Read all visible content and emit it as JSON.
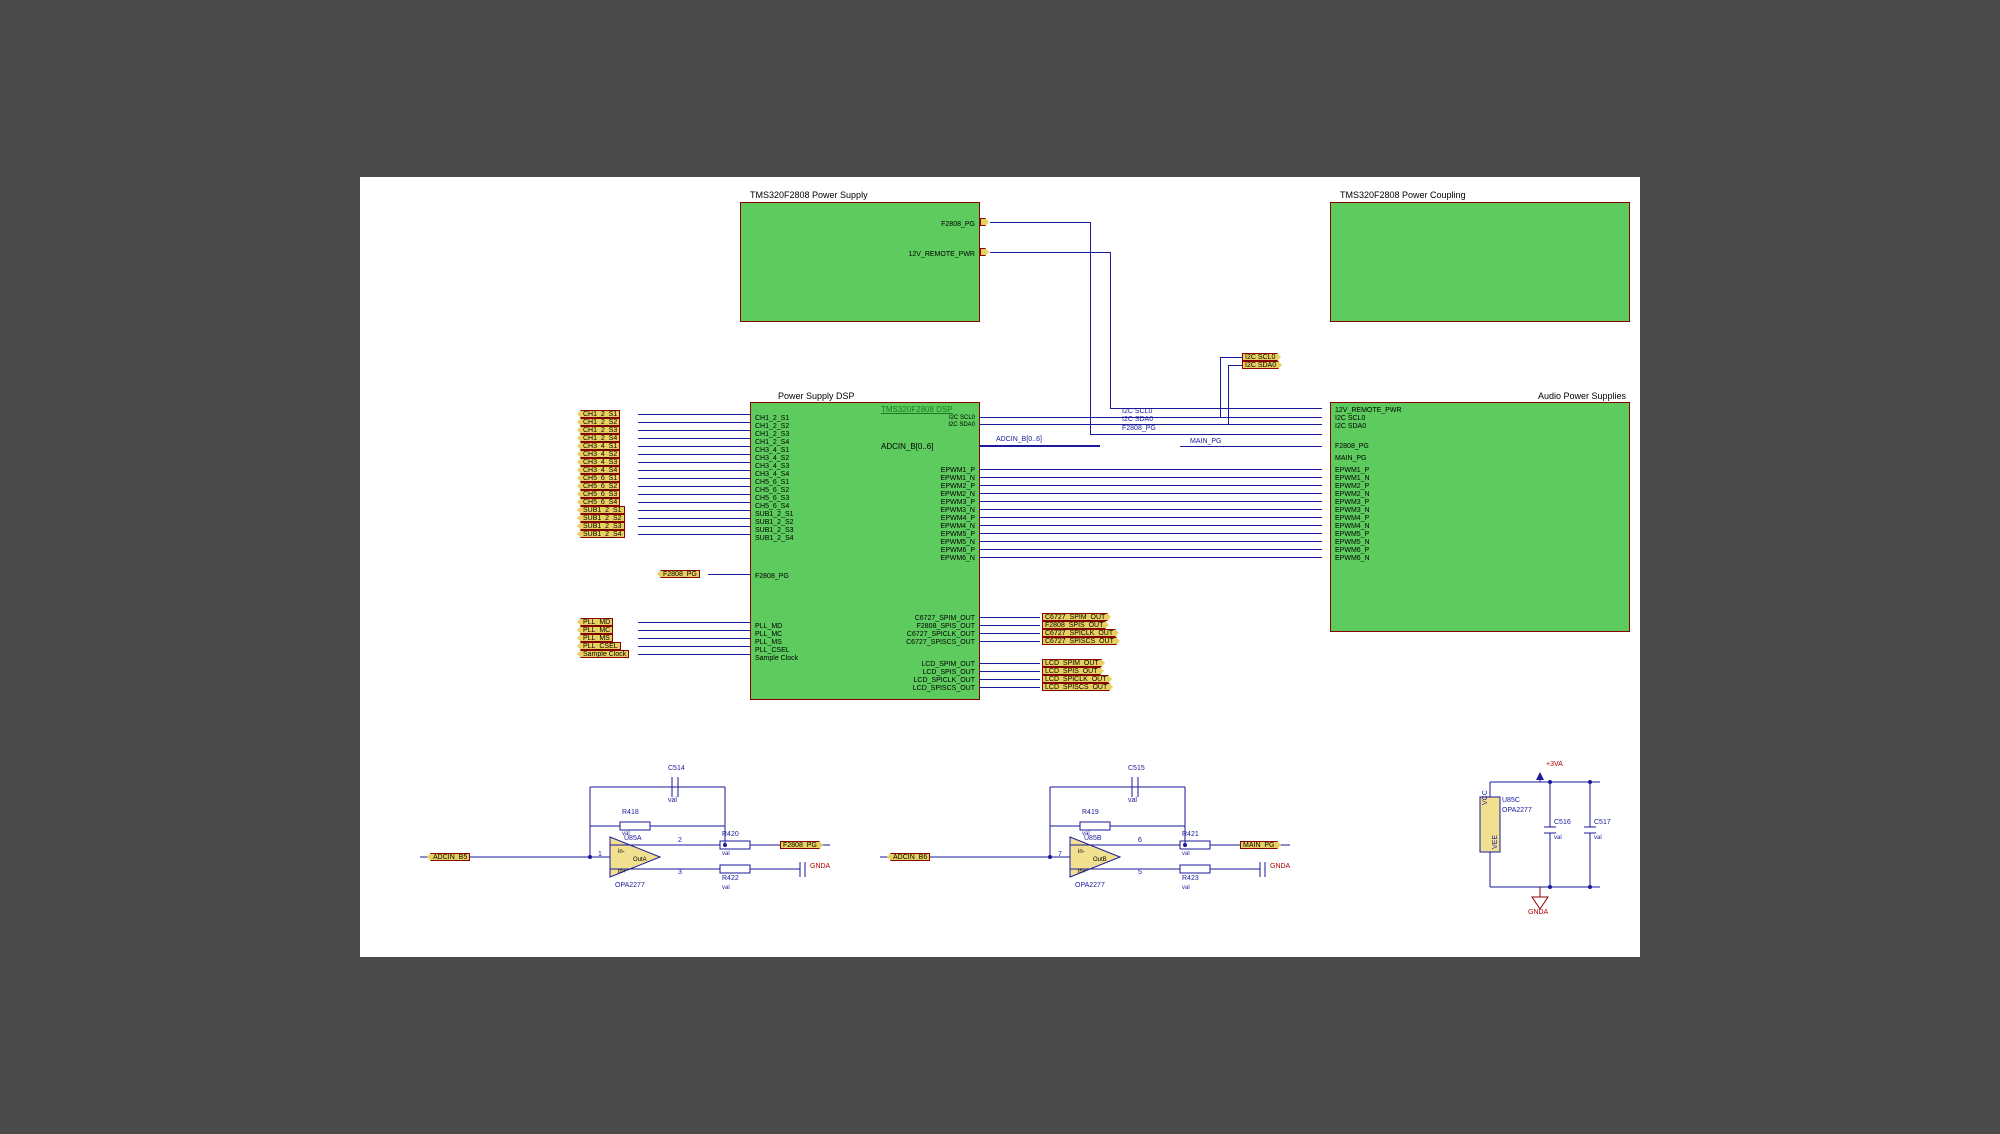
{
  "blocks": {
    "ps": {
      "title": "TMS320F2808 Power Supply",
      "link": "",
      "pins": [
        "F2808_PG",
        "12V_REMOTE_PWR"
      ]
    },
    "pc": {
      "title": "TMS320F2808 Power Coupling"
    },
    "dsp": {
      "title": "Power Supply DSP",
      "link": "TMS320F2808 DSP",
      "left_pins": [
        "CH1_2_S1",
        "CH1_2_S2",
        "CH1_2_S3",
        "CH1_2_S4",
        "CH3_4_S1",
        "CH3_4_S2",
        "CH3_4_S3",
        "CH3_4_S4",
        "CH5_6_S1",
        "CH5_6_S2",
        "CH5_6_S3",
        "CH5_6_S4",
        "SUB1_2_S1",
        "SUB1_2_S2",
        "SUB1_2_S3",
        "SUB1_2_S4"
      ],
      "left_f2808": "F2808_PG",
      "left_pll": [
        "PLL_MD",
        "PLL_MC",
        "PLL_MS",
        "PLL_CSEL",
        "Sample Clock"
      ],
      "right_top": [
        "I2C SCL0",
        "I2C SDA0"
      ],
      "adc_label": "ADCIN_B[0..6]",
      "right_epwm": [
        "EPWM1_P",
        "EPWM1_N",
        "EPWM2_P",
        "EPWM2_N",
        "EPWM3_P",
        "EPWM3_N",
        "EPWM4_P",
        "EPWM4_N",
        "EPWM5_P",
        "EPWM5_N",
        "EPWM6_P",
        "EPWM6_N"
      ],
      "right_spi1": [
        "C6727_SPIM_OUT",
        "F2808_SPIS_OUT",
        "C6727_SPICLK_OUT",
        "C6727_SPISCS_OUT"
      ],
      "right_spi2": [
        "LCD_SPIM_OUT",
        "LCD_SPIS_OUT",
        "LCD_SPICLK_OUT",
        "LCD_SPISCS_OUT"
      ]
    },
    "aps": {
      "title": "Audio Power Supplies",
      "pins": [
        "12V_REMOTE_PWR",
        "I2C SCL0",
        "I2C SDA0",
        "F2808_PG",
        "MAIN_PG",
        "EPWM1_P",
        "EPWM1_N",
        "EPWM2_P",
        "EPWM2_N",
        "EPWM3_P",
        "EPWM3_N",
        "EPWM4_P",
        "EPWM4_N",
        "EPWM5_P",
        "EPWM5_N",
        "EPWM6_P",
        "EPWM6_N"
      ]
    }
  },
  "nets": {
    "i2c": {
      "scl": "I2C SCL0",
      "sda": "I2C SDA0"
    },
    "f2808_pg": "F2808_PG",
    "main_pg": "MAIN_PG",
    "adc_wire": "ADCIN_B[0..6]"
  },
  "ports": {
    "dsp_left_ch": [
      "CH1_2_S1",
      "CH1_2_S2",
      "CH1_2_S3",
      "CH1_2_S4",
      "CH3_4_S1",
      "CH3_4_S2",
      "CH3_4_S3",
      "CH3_4_S4",
      "CH5_6_S1",
      "CH5_6_S2",
      "CH5_6_S3",
      "CH5_6_S4",
      "SUB1_2_S1",
      "SUB1_2_S2",
      "SUB1_2_S3",
      "SUB1_2_S4"
    ],
    "dsp_left_f2808": "F2808_PG",
    "dsp_left_pll": [
      "PLL_MD",
      "PLL_MC",
      "PLL_MS",
      "PLL_CSEL",
      "Sample Clock"
    ],
    "spi1": [
      "C6727_SPIM_OUT",
      "F2808_SPIS_OUT",
      "C6727_SPICLK_OUT",
      "C6727_SPISCS_OUT"
    ],
    "spi2": [
      "LCD_SPIM_OUT",
      "LCD_SPIS_OUT",
      "LCD_SPICLK_OUT",
      "LCD_SPISCS_OUT"
    ]
  },
  "opamp1": {
    "in_port": "ADCIN_B5",
    "out_port": "F2808_PG",
    "ref": "U85A",
    "part": "OPA2277",
    "c": "C514",
    "cval": "val",
    "r_fb": "R418",
    "r_fb_val": "val",
    "r_out": "R420",
    "r_out_val": "val",
    "r_gnd": "R422",
    "r_gnd_val": "val",
    "pins": {
      "out": "1",
      "m": "2",
      "p": "3"
    },
    "gnd": "GNDA"
  },
  "opamp2": {
    "in_port": "ADCIN_B6",
    "out_port": "MAIN_PG",
    "ref": "U85B",
    "part": "OPA2277",
    "c": "C515",
    "cval": "val",
    "r_fb": "R419",
    "r_fb_val": "val",
    "r_out": "R421",
    "r_out_val": "val",
    "r_gnd": "R423",
    "r_gnd_val": "val",
    "pins": {
      "out": "7",
      "m": "6",
      "p": "5"
    },
    "gnd": "GNDA"
  },
  "power": {
    "p_rail": "+3VA",
    "ref": "U85C",
    "part": "OPA2277",
    "vcc": "VCC",
    "vee": "VEE",
    "c1": "C516",
    "c1v": "val",
    "c2": "C517",
    "c2v": "val",
    "gnd": "GNDA"
  }
}
